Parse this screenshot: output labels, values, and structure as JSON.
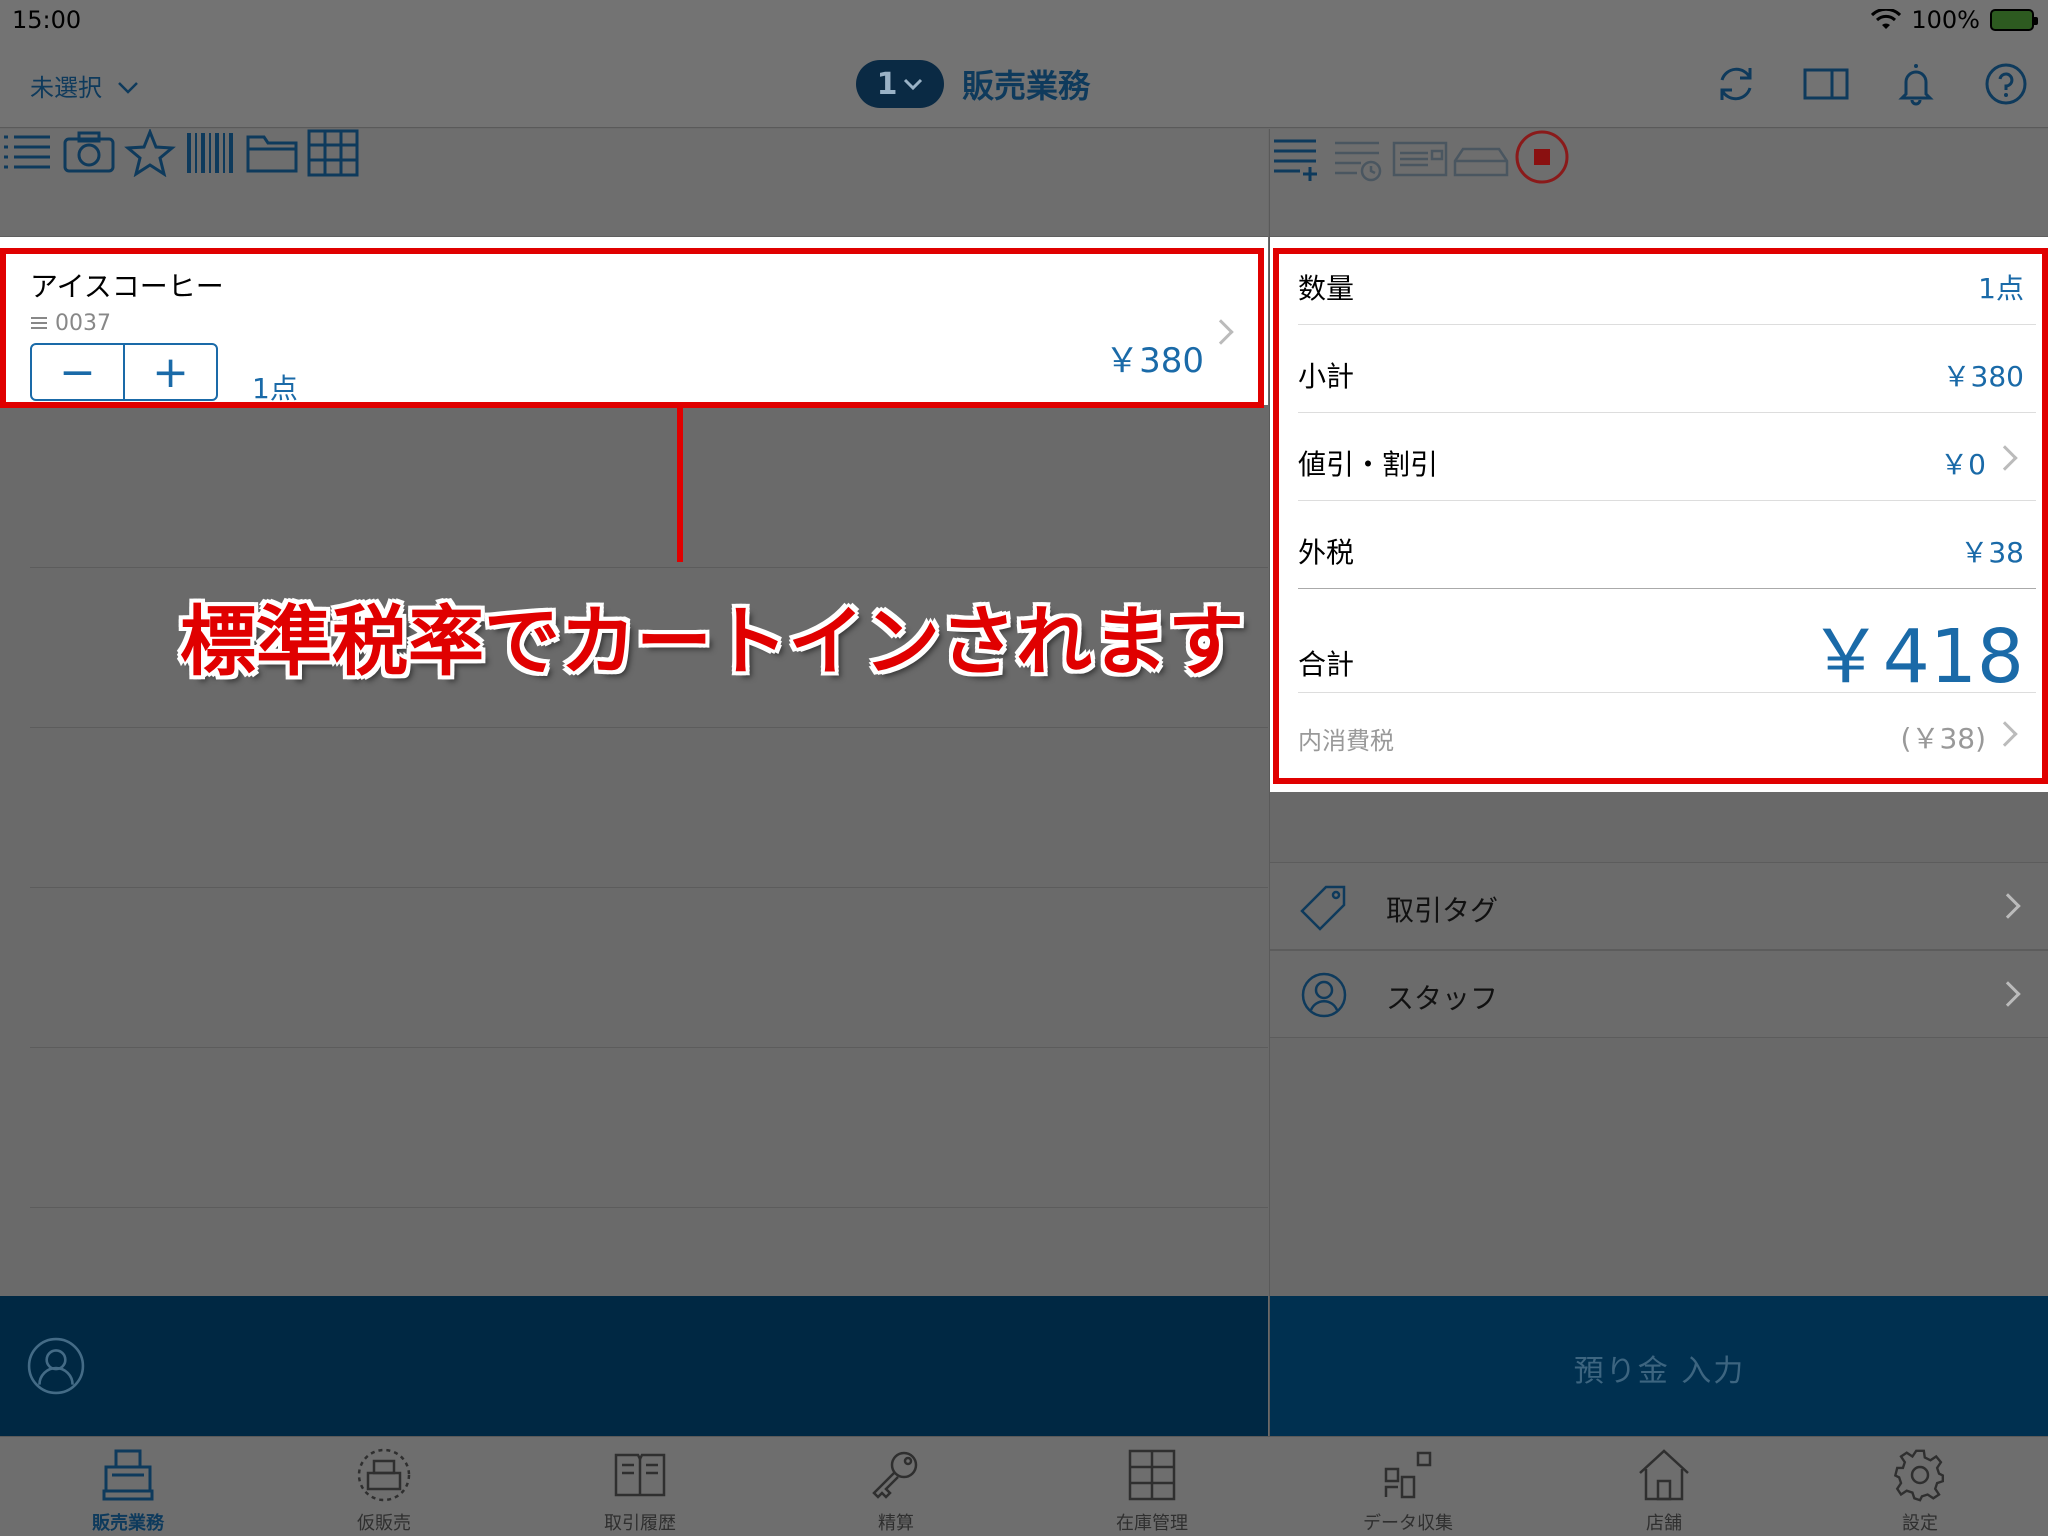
{
  "status": {
    "time": "15:00",
    "battery": "100%"
  },
  "nav": {
    "store": "未選択",
    "register_no": "1",
    "title": "販売業務"
  },
  "cart": {
    "item": {
      "name": "アイスコーヒー",
      "code": "0037",
      "qty": "1点",
      "price": "￥380",
      "minus": "−",
      "plus": "+"
    }
  },
  "summary": {
    "quantity_label": "数量",
    "quantity_value": "1点",
    "subtotal_label": "小計",
    "subtotal_value": "￥380",
    "discount_label": "値引・割引",
    "discount_value": "￥0",
    "tax_label": "外税",
    "tax_value": "￥38",
    "total_label": "合計",
    "total_value": "￥418",
    "inner_tax_label": "内消費税",
    "inner_tax_value": "(￥38)"
  },
  "menu": {
    "tag_label": "取引タグ",
    "staff_label": "スタッフ"
  },
  "deposit_label": "預り金 入力",
  "tabs": [
    {
      "label": "販売業務",
      "icon": "register-icon"
    },
    {
      "label": "仮販売",
      "icon": "temp-sale-icon"
    },
    {
      "label": "取引履歴",
      "icon": "history-icon"
    },
    {
      "label": "精算",
      "icon": "key-icon"
    },
    {
      "label": "在庫管理",
      "icon": "inventory-icon"
    },
    {
      "label": "データ収集",
      "icon": "data-icon"
    },
    {
      "label": "店舗",
      "icon": "store-icon"
    },
    {
      "label": "設定",
      "icon": "gear-icon"
    }
  ],
  "annotation": {
    "text": "標準税率でカートインされます"
  },
  "colors": {
    "accent": "#1a6aa8",
    "navy": "#002843",
    "annotation_red": "#e00000"
  }
}
